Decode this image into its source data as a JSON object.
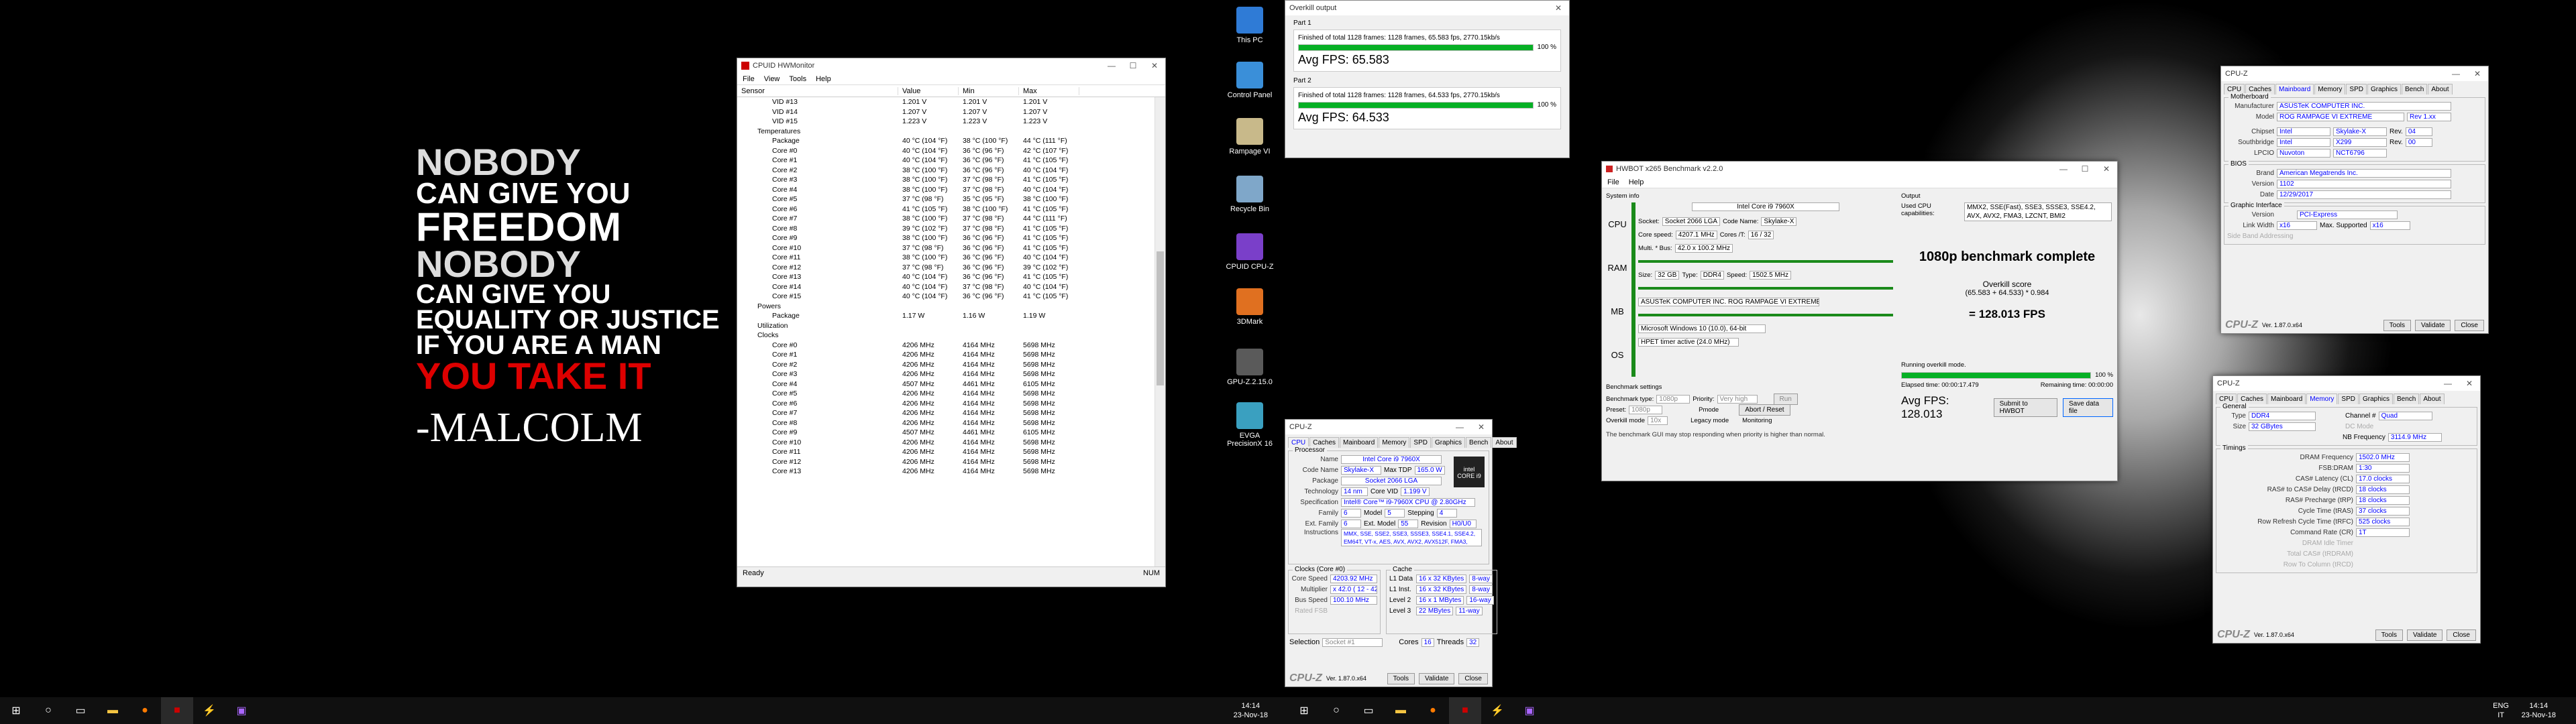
{
  "poster": {
    "l1": "NOBODY",
    "l2": "CAN GIVE YOU",
    "l3": "FREEDOM",
    "l4": "NOBODY",
    "l5": "CAN GIVE YOU",
    "l6": "EQUALITY OR JUSTICE",
    "l7": "IF YOU ARE A MAN",
    "l8": "YOU TAKE IT",
    "l9": "-MALCOLM"
  },
  "hwmon": {
    "title": "CPUID HWMonitor",
    "menu": [
      "File",
      "View",
      "Tools",
      "Help"
    ],
    "cols": [
      "Sensor",
      "Value",
      "Min",
      "Max"
    ],
    "rows": [
      [
        "VID #13",
        "1.201 V",
        "1.201 V",
        "1.201 V"
      ],
      [
        "VID #14",
        "1.207 V",
        "1.207 V",
        "1.207 V"
      ],
      [
        "VID #15",
        "1.223 V",
        "1.223 V",
        "1.223 V"
      ],
      [
        "Temperatures",
        "",
        "",
        ""
      ],
      [
        "Package",
        "40 °C (104 °F)",
        "38 °C (100 °F)",
        "44 °C (111 °F)"
      ],
      [
        "Core #0",
        "40 °C (104 °F)",
        "36 °C (96 °F)",
        "42 °C (107 °F)"
      ],
      [
        "Core #1",
        "40 °C (104 °F)",
        "36 °C (96 °F)",
        "41 °C (105 °F)"
      ],
      [
        "Core #2",
        "38 °C (100 °F)",
        "36 °C (96 °F)",
        "40 °C (104 °F)"
      ],
      [
        "Core #3",
        "38 °C (100 °F)",
        "37 °C (98 °F)",
        "41 °C (105 °F)"
      ],
      [
        "Core #4",
        "38 °C (100 °F)",
        "37 °C (98 °F)",
        "40 °C (104 °F)"
      ],
      [
        "Core #5",
        "37 °C (98 °F)",
        "35 °C (95 °F)",
        "38 °C (100 °F)"
      ],
      [
        "Core #6",
        "41 °C (105 °F)",
        "38 °C (100 °F)",
        "41 °C (105 °F)"
      ],
      [
        "Core #7",
        "38 °C (100 °F)",
        "37 °C (98 °F)",
        "44 °C (111 °F)"
      ],
      [
        "Core #8",
        "39 °C (102 °F)",
        "37 °C (98 °F)",
        "41 °C (105 °F)"
      ],
      [
        "Core #9",
        "38 °C (100 °F)",
        "36 °C (96 °F)",
        "41 °C (105 °F)"
      ],
      [
        "Core #10",
        "37 °C (98 °F)",
        "36 °C (96 °F)",
        "41 °C (105 °F)"
      ],
      [
        "Core #11",
        "38 °C (100 °F)",
        "36 °C (96 °F)",
        "40 °C (104 °F)"
      ],
      [
        "Core #12",
        "37 °C (98 °F)",
        "36 °C (96 °F)",
        "39 °C (102 °F)"
      ],
      [
        "Core #13",
        "40 °C (104 °F)",
        "36 °C (96 °F)",
        "41 °C (105 °F)"
      ],
      [
        "Core #14",
        "40 °C (104 °F)",
        "37 °C (98 °F)",
        "40 °C (104 °F)"
      ],
      [
        "Core #15",
        "40 °C (104 °F)",
        "36 °C (96 °F)",
        "41 °C (105 °F)"
      ],
      [
        "Powers",
        "",
        "",
        ""
      ],
      [
        "Package",
        "1.17 W",
        "1.16 W",
        "1.19 W"
      ],
      [
        "Utilization",
        "",
        "",
        ""
      ],
      [
        "Clocks",
        "",
        "",
        ""
      ],
      [
        "Core #0",
        "4206 MHz",
        "4164 MHz",
        "5698 MHz"
      ],
      [
        "Core #1",
        "4206 MHz",
        "4164 MHz",
        "5698 MHz"
      ],
      [
        "Core #2",
        "4206 MHz",
        "4164 MHz",
        "5698 MHz"
      ],
      [
        "Core #3",
        "4206 MHz",
        "4164 MHz",
        "5698 MHz"
      ],
      [
        "Core #4",
        "4507 MHz",
        "4461 MHz",
        "6105 MHz"
      ],
      [
        "Core #5",
        "4206 MHz",
        "4164 MHz",
        "5698 MHz"
      ],
      [
        "Core #6",
        "4206 MHz",
        "4164 MHz",
        "5698 MHz"
      ],
      [
        "Core #7",
        "4206 MHz",
        "4164 MHz",
        "5698 MHz"
      ],
      [
        "Core #8",
        "4206 MHz",
        "4164 MHz",
        "5698 MHz"
      ],
      [
        "Core #9",
        "4507 MHz",
        "4461 MHz",
        "6105 MHz"
      ],
      [
        "Core #10",
        "4206 MHz",
        "4164 MHz",
        "5698 MHz"
      ],
      [
        "Core #11",
        "4206 MHz",
        "4164 MHz",
        "5698 MHz"
      ],
      [
        "Core #12",
        "4206 MHz",
        "4164 MHz",
        "5698 MHz"
      ],
      [
        "Core #13",
        "4206 MHz",
        "4164 MHz",
        "5698 MHz"
      ]
    ],
    "status_left": "Ready",
    "status_right": "NUM"
  },
  "desktop_icons": [
    "This PC",
    "Control Panel",
    "Rampage VI",
    "Recycle Bin",
    "CPUID CPU-Z",
    "3DMark",
    "GPU-Z.2.15.0",
    "EVGA PrecisionX 16"
  ],
  "clock1": {
    "time": "14:14",
    "date": "23-Nov-18"
  },
  "clock2": {
    "time": "14:14",
    "date": "23-Nov-18"
  },
  "tray": {
    "lang": "ENG",
    "kbd": "IT"
  },
  "overkill": {
    "title": "Overkill output",
    "part1": "Part 1",
    "p1text": "Finished of total 1128 frames: 1128 frames, 65.583 fps, 2770.15kb/s",
    "p1pct": "100 %",
    "p1fps": "Avg FPS: 65.583",
    "part2": "Part 2",
    "p2text": "Finished of total 1128 frames: 1128 frames, 64.533 fps, 2770.15kb/s",
    "p2pct": "100 %",
    "p2fps": "Avg FPS: 64.533",
    "progress": 1.0
  },
  "hwbot": {
    "title": "HWBOT x265 Benchmark v2.2.0",
    "menu": [
      "File",
      "Help"
    ],
    "sysinfo": "System info",
    "output": "Output",
    "socket_l": "Socket:",
    "socket": "Socket 2066 LGA",
    "cpu_name": "Intel Core i9 7960X",
    "codename_l": "Code Name:",
    "codename": "Skylake-X",
    "corespeed_l": "Core speed:",
    "corespeed": "4207.1 MHz",
    "cores_l": "Cores /T:",
    "cores": "16 / 32",
    "multi_l": "Multi. * Bus:",
    "multi": "42.0 x 100.2 MHz",
    "size_l": "Size:",
    "size": "32 GB",
    "type_l": "Type:",
    "type": "DDR4",
    "speed_l": "Speed:",
    "speed": "1502.5 MHz",
    "mb": "ASUSTeK COMPUTER INC. ROG RAMPAGE VI EXTREME",
    "os": "Microsoft Windows 10 (10.0), 64-bit",
    "timer": "HPET timer active (24.0 MHz)",
    "cap_l": "Used CPU capabilities:",
    "caps": "MMX2, SSE(Fast), SSE3, SSSE3, SSE4.2, AVX, AVX2, FMA3, LZCNT, BMI2",
    "complete": "1080p benchmark complete",
    "score_l": "Overkill score",
    "formula": "(65.583 + 64.533) * 0.984",
    "score": "= 128.013 FPS",
    "bs": "Benchmark settings",
    "btype_l": "Benchmark type:",
    "btype": "1080p",
    "prio_l": "Priority:",
    "prio": "Very high",
    "run": "Run",
    "preset_l": "Preset:",
    "preset": "1080p",
    "pmode": "Pmode",
    "abort": "Abort / Reset",
    "om": "Overkill mode",
    "om_val": "10x",
    "legacy": "Legacy mode",
    "monitoring": "Monitoring",
    "running": "Running overkill mode.",
    "pct": "100 %",
    "elapsed": "Elapsed time: 00:00:17.479",
    "remaining": "Remaining time: 00:00:00",
    "avg": "Avg FPS: 128.013",
    "submit": "Submit to HWBOT",
    "save": "Save data file",
    "warning": "The benchmark GUI may stop responding when priority is higher than normal.",
    "progress": 1.0
  },
  "cpuz_cpu": {
    "title": "CPU-Z",
    "tabs": [
      "CPU",
      "Caches",
      "Mainboard",
      "Memory",
      "SPD",
      "Graphics",
      "Bench",
      "About"
    ],
    "processor": "Processor",
    "name_l": "Name",
    "name": "Intel Core i9 7960X",
    "code_l": "Code Name",
    "code": "Skylake-X",
    "tdp_l": "Max TDP",
    "tdp": "165.0 W",
    "pkg_l": "Package",
    "pkg": "Socket 2066 LGA",
    "tech_l": "Technology",
    "tech": "14 nm",
    "vid_l": "Core VID",
    "vid": "1.199 V",
    "spec_l": "Specification",
    "spec": "Intel® Core™ i9-7960X CPU @ 2.80GHz",
    "fam_l": "Family",
    "fam": "6",
    "mod_l": "Model",
    "mod": "5",
    "step_l": "Stepping",
    "step": "4",
    "efam_l": "Ext. Family",
    "efam": "6",
    "emod_l": "Ext. Model",
    "emod": "55",
    "rev_l": "Revision",
    "rev": "H0/U0",
    "inst_l": "Instructions",
    "inst": "MMX, SSE, SSE2, SSE3, SSSE3, SSE4.1, SSE4.2, EM64T, VT-x, AES, AVX, AVX2, AVX512F, FMA3, TSX",
    "clocks": "Clocks (Core #0)",
    "cspeed_l": "Core Speed",
    "cspeed": "4203.92 MHz",
    "mult_l": "Multiplier",
    "mult": "x 42.0 ( 12 - 42 )",
    "bus_l": "Bus Speed",
    "bus": "100.10 MHz",
    "fsb_l": "Rated FSB",
    "cache": "Cache",
    "l1d_l": "L1 Data",
    "l1d": "16 x 32 KBytes",
    "l1d_w": "8-way",
    "l1i_l": "L1 Inst.",
    "l1i": "16 x 32 KBytes",
    "l1i_w": "8-way",
    "l2_l": "Level 2",
    "l2": "16 x 1 MBytes",
    "l2_w": "16-way",
    "l3_l": "Level 3",
    "l3": "22 MBytes",
    "l3_w": "11-way",
    "sel_l": "Selection",
    "sel": "Socket #1",
    "cores_l": "Cores",
    "cores": "16",
    "thr_l": "Threads",
    "thr": "32",
    "ver": "Ver. 1.87.0.x64",
    "tools": "Tools",
    "validate": "Validate",
    "close": "Close",
    "brand": "CPU-Z"
  },
  "cpuz_mb": {
    "title": "CPU-Z",
    "tabs": [
      "CPU",
      "Caches",
      "Mainboard",
      "Memory",
      "SPD",
      "Graphics",
      "Bench",
      "About"
    ],
    "mb": "Motherboard",
    "man_l": "Manufacturer",
    "man": "ASUSTeK COMPUTER INC.",
    "model_l": "Model",
    "model": "ROG RAMPAGE VI EXTREME",
    "model_rev": "Rev 1.xx",
    "chip_l": "Chipset",
    "chip_v": "Intel",
    "chip": "Skylake-X",
    "chip_rev_l": "Rev.",
    "chip_rev": "04",
    "sb_l": "Southbridge",
    "sb_v": "Intel",
    "sb": "X299",
    "sb_rev_l": "Rev.",
    "sb_rev": "00",
    "lpcio_l": "LPCIO",
    "lpcio_v": "Nuvoton",
    "lpcio": "NCT6796",
    "bios": "BIOS",
    "brand_l": "Brand",
    "brand": "American Megatrends Inc.",
    "ver_l": "Version",
    "ver": "1102",
    "date_l": "Date",
    "date": "12/29/2017",
    "gi": "Graphic Interface",
    "gver_l": "Version",
    "gver": "PCI-Express",
    "lw_l": "Link Width",
    "lw": "x16",
    "ms_l": "Max. Supported",
    "ms": "x16",
    "sba_l": "Side Band Addressing",
    "ver_foot": "Ver. 1.87.0.x64",
    "tools": "Tools",
    "validate": "Validate",
    "close": "Close",
    "brandf": "CPU-Z"
  },
  "cpuz_mem": {
    "title": "CPU-Z",
    "tabs": [
      "CPU",
      "Caches",
      "Mainboard",
      "Memory",
      "SPD",
      "Graphics",
      "Bench",
      "About"
    ],
    "general": "General",
    "type_l": "Type",
    "type": "DDR4",
    "ch_l": "Channel #",
    "ch": "Quad",
    "size_l": "Size",
    "size": "32 GBytes",
    "dc_l": "DC Mode",
    "nb_l": "NB Frequency",
    "nb": "3114.9 MHz",
    "timings": "Timings",
    "t": [
      [
        "DRAM Frequency",
        "1502.0 MHz"
      ],
      [
        "FSB:DRAM",
        "1:30"
      ],
      [
        "CAS# Latency (CL)",
        "17.0 clocks"
      ],
      [
        "RAS# to CAS# Delay (tRCD)",
        "18 clocks"
      ],
      [
        "RAS# Precharge (tRP)",
        "18 clocks"
      ],
      [
        "Cycle Time (tRAS)",
        "37 clocks"
      ],
      [
        "Row Refresh Cycle Time (tRFC)",
        "525 clocks"
      ],
      [
        "Command Rate (CR)",
        "1T"
      ],
      [
        "DRAM Idle Timer",
        ""
      ],
      [
        "Total CAS# (tRDRAM)",
        ""
      ],
      [
        "Row To Column (tRCD)",
        ""
      ]
    ],
    "ver_foot": "Ver. 1.87.0.x64",
    "tools": "Tools",
    "validate": "Validate",
    "close": "Close",
    "brandf": "CPU-Z"
  }
}
